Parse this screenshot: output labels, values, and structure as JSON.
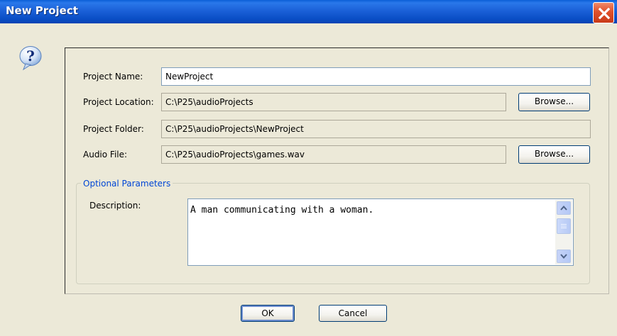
{
  "window": {
    "title": "New Project"
  },
  "form": {
    "project_name_label": "Project Name:",
    "project_name_value": "NewProject",
    "project_location_label": "Project Location:",
    "project_location_value": "C:\\P25\\audioProjects",
    "project_folder_label": "Project Folder:",
    "project_folder_value": "C:\\P25\\audioProjects\\NewProject",
    "audio_file_label": "Audio File:",
    "audio_file_value": "C:\\P25\\audioProjects\\games.wav",
    "browse_label": "Browse...",
    "browse_label_2": "Browse..."
  },
  "optional": {
    "title": "Optional Parameters",
    "description_label": "Description:",
    "description_value": "A man communicating with a woman."
  },
  "buttons": {
    "ok": "OK",
    "cancel": "Cancel"
  },
  "icons": {
    "dialog_icon": "question-icon",
    "close": "close-icon",
    "scroll_up": "chevron-up-icon",
    "scroll_down": "chevron-down-icon"
  },
  "colors": {
    "titlebar": "#0a4ec6",
    "dialog_bg": "#ece9d8",
    "group_title": "#0046d5",
    "close_button": "#e0502a"
  }
}
